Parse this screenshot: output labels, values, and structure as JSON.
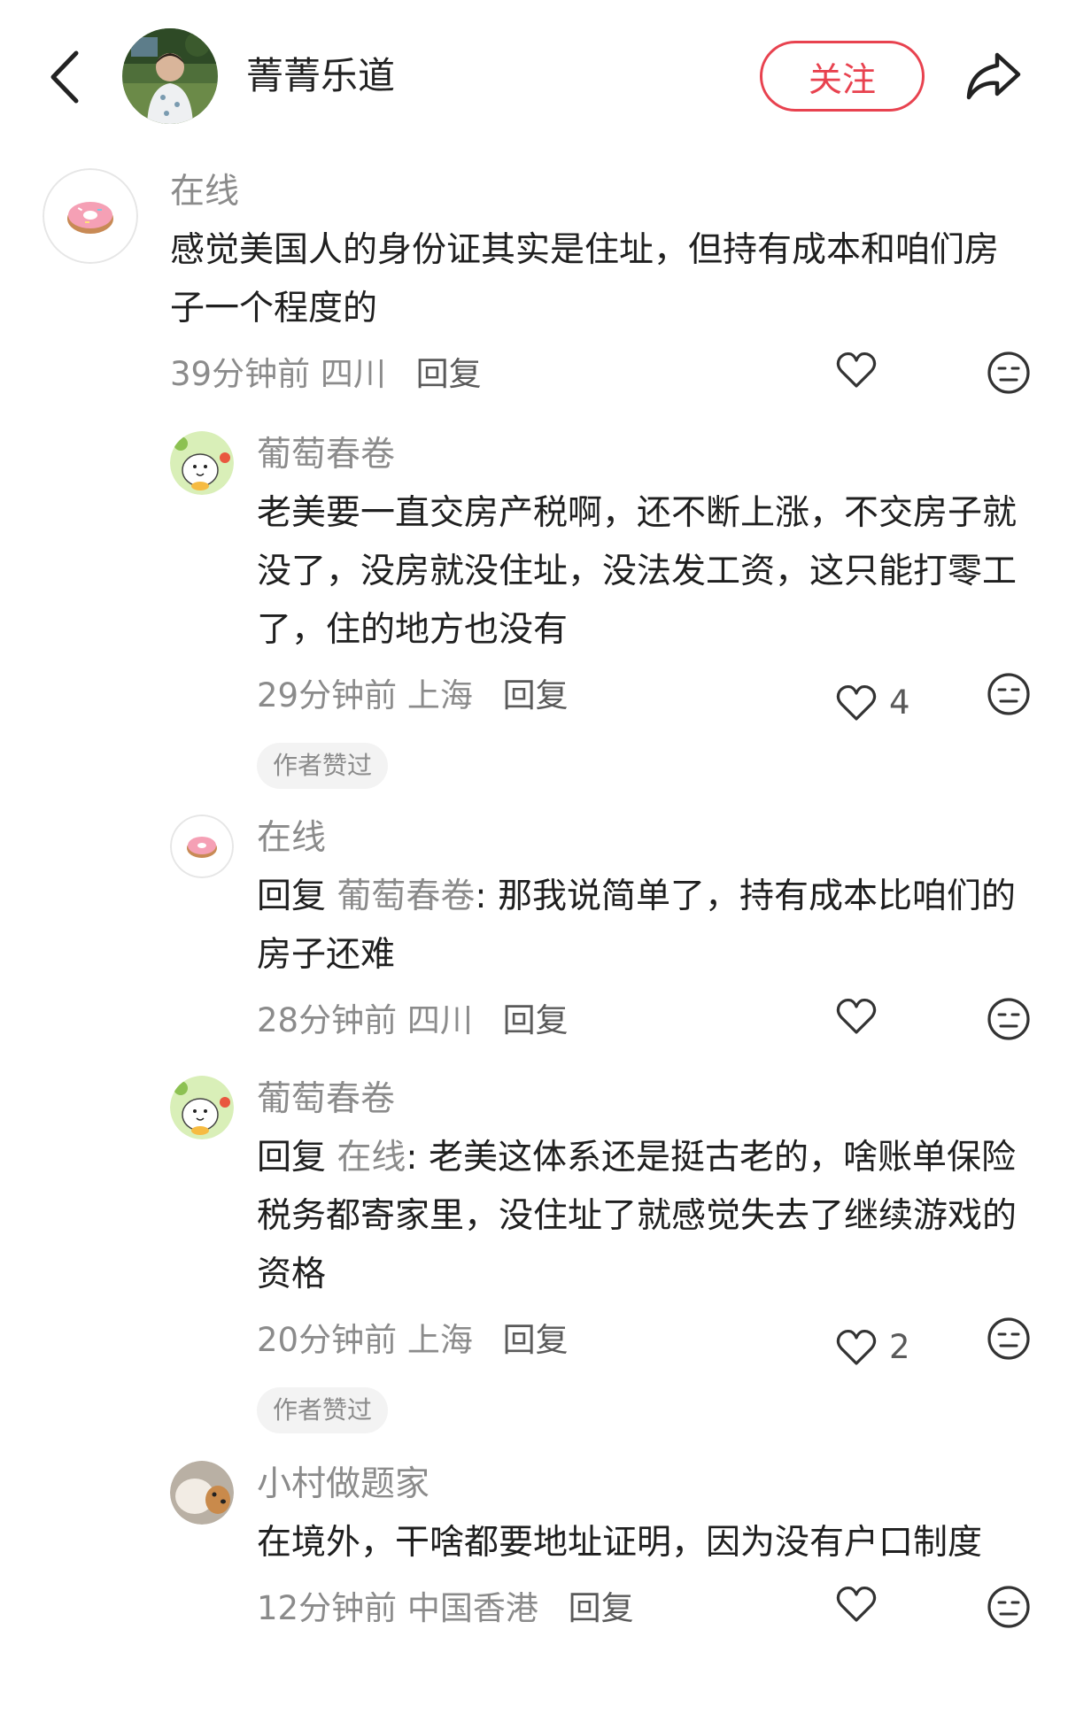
{
  "header": {
    "author_name": "菁菁乐道",
    "follow_label": "关注"
  },
  "colors": {
    "accent": "#e8424f",
    "muted_text": "#8b8b8b",
    "badge_bg": "#f3f3f3"
  },
  "comments": [
    {
      "level": "top",
      "avatar_icon": "donut-avatar",
      "name": "在线",
      "reply_prefix": "",
      "reply_to": "",
      "text": "感觉美国人的身份证其实是住址，但持有成本和咱们房子一个程度的",
      "time": "39分钟前",
      "location": "四川",
      "reply_label": "回复",
      "likes": "",
      "badge": ""
    },
    {
      "level": "sub",
      "avatar_icon": "green-cartoon-avatar",
      "name": "葡萄春卷",
      "reply_prefix": "",
      "reply_to": "",
      "text": "老美要一直交房产税啊，还不断上涨，不交房子就没了，没房就没住址，没法发工资，这只能打零工了，住的地方也没有",
      "time": "29分钟前",
      "location": "上海",
      "reply_label": "回复",
      "likes": "4",
      "badge": "作者赞过"
    },
    {
      "level": "sub",
      "avatar_icon": "donut-avatar",
      "name": "在线",
      "reply_prefix": "回复 ",
      "reply_to": "葡萄春卷",
      "text": ": 那我说简单了，持有成本比咱们的房子还难",
      "time": "28分钟前",
      "location": "四川",
      "reply_label": "回复",
      "likes": "",
      "badge": ""
    },
    {
      "level": "sub",
      "avatar_icon": "green-cartoon-avatar",
      "name": "葡萄春卷",
      "reply_prefix": "回复 ",
      "reply_to": "在线",
      "text": ": 老美这体系还是挺古老的，啥账单保险税务都寄家里，没住址了就感觉失去了继续游戏的资格",
      "time": "20分钟前",
      "location": "上海",
      "reply_label": "回复",
      "likes": "2",
      "badge": "作者赞过"
    },
    {
      "level": "sub",
      "avatar_icon": "dog-avatar",
      "name": "小村做题家",
      "reply_prefix": "",
      "reply_to": "",
      "text": "在境外，干啥都要地址证明，因为没有户口制度",
      "time": "12分钟前",
      "location": "中国香港",
      "reply_label": "回复",
      "likes": "",
      "badge": ""
    }
  ]
}
